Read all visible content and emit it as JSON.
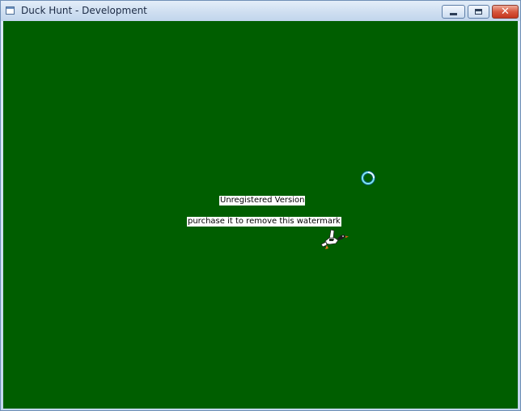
{
  "window": {
    "title": "Duck Hunt - Development",
    "background_color": "#005e00"
  },
  "titlebar_buttons": {
    "minimize_icon": "minimize-icon",
    "maximize_icon": "restore-icon",
    "close_label": "✕"
  },
  "game": {
    "watermark_line1": "Unregistered Version",
    "watermark_line2": "purchase it to remove this watermark",
    "sprites": [
      "busy-cursor-ring",
      "duck-sprite"
    ]
  }
}
